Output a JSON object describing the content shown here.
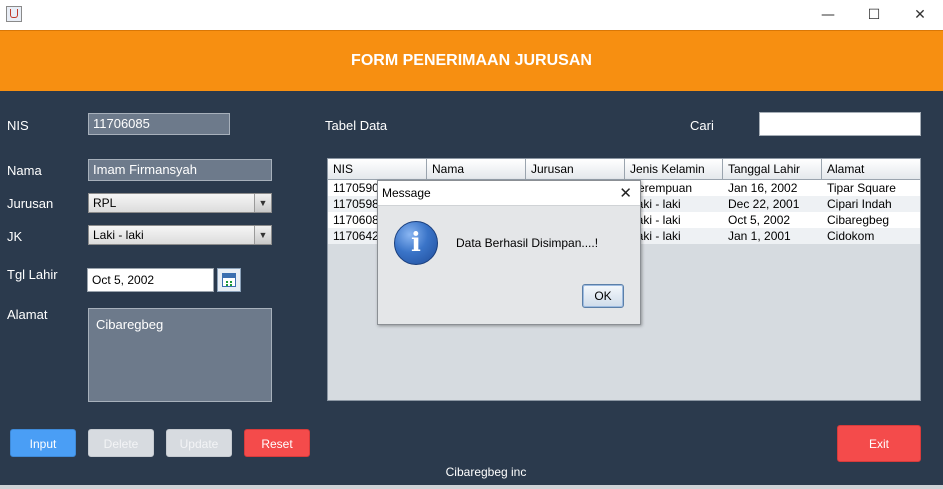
{
  "window": {
    "minimize_glyph": "—",
    "maximize_glyph": "☐",
    "close_glyph": "✕"
  },
  "header": {
    "title": "FORM PENERIMAAN JURUSAN"
  },
  "form": {
    "nis_label": "NIS",
    "nis_value": "11706085",
    "nama_label": "Nama",
    "nama_value": "Imam Firmansyah",
    "jurusan_label": "Jurusan",
    "jurusan_value": "RPL",
    "jk_label": "JK",
    "jk_value": "Laki - laki",
    "tgl_label": "Tgl Lahir",
    "tgl_value": "Oct 5, 2002",
    "alamat_label": "Alamat",
    "alamat_value": "Cibaregbeg"
  },
  "table": {
    "label": "Tabel Data",
    "search_label": "Cari",
    "search_value": "",
    "columns": [
      "NIS",
      "Nama",
      "Jurusan",
      "Jenis Kelamin",
      "Tanggal Lahir",
      "Alamat"
    ],
    "rows": [
      [
        "11705907",
        "",
        "",
        "Perempuan",
        "Jan 16, 2002",
        "Tipar Square"
      ],
      [
        "11705987",
        "",
        "",
        "Laki - laki",
        "Dec 22, 2001",
        "Cipari Indah"
      ],
      [
        "11706085",
        "",
        "",
        "Laki - laki",
        "Oct 5, 2002",
        "Cibaregbeg"
      ],
      [
        "11706421",
        "",
        "",
        "Laki - laki",
        "Jan 1, 2001",
        "Cidokom"
      ]
    ]
  },
  "buttons": {
    "input": "Input",
    "delete": "Delete",
    "update": "Update",
    "reset": "Reset",
    "exit": "Exit"
  },
  "footer": {
    "text": "Cibaregbeg inc"
  },
  "dialog": {
    "title": "Message",
    "message": "Data Berhasil Disimpan....!",
    "ok": "OK",
    "icon": "info-icon",
    "icon_glyph": "i"
  },
  "colors": {
    "header_bg": "#f78f11",
    "panel_bg": "#2b3a4d",
    "input_button": "#4a9ef5",
    "reset_button": "#f44b4b",
    "exit_button": "#f44b4b"
  }
}
